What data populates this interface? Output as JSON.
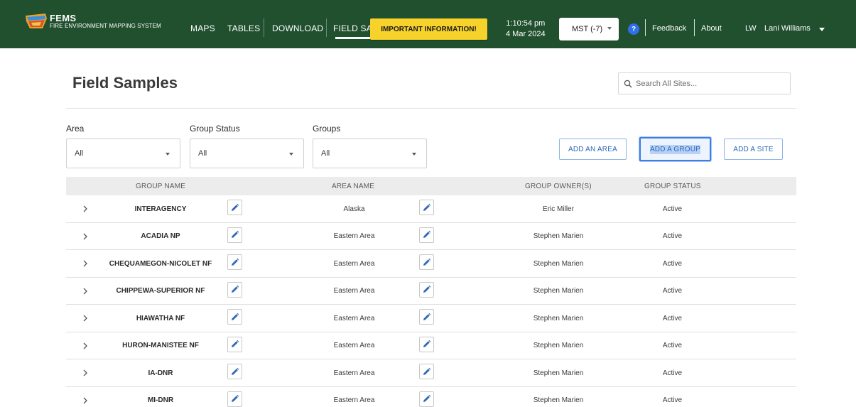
{
  "header": {
    "brand_name": "FEMS",
    "brand_subtitle": "FIRE ENVIRONMENT MAPPING SYSTEM",
    "nav": [
      "MAPS",
      "TABLES",
      "DOWNLOAD",
      "FIELD SA"
    ],
    "active_nav": "FIELD SAMPLES",
    "important_label": "IMPORTANT INFORMATION!",
    "time": "1:10:54 pm",
    "date": "4 Mar 2024",
    "timezone": "MST (-7)",
    "help_label": "?",
    "feedback_label": "Feedback",
    "about_label": "About",
    "user_initials": "LW",
    "user_name": "Lani Williams",
    "colors": {
      "bar": "#21502f",
      "important": "#f6d22b",
      "help": "#2f6fe8"
    }
  },
  "page": {
    "title": "Field Samples",
    "search_placeholder": "Search All Sites..."
  },
  "filters": [
    {
      "label": "Area",
      "value": "All"
    },
    {
      "label": "Group Status",
      "value": "All"
    },
    {
      "label": "Groups",
      "value": "All"
    }
  ],
  "actions": {
    "add_area": "ADD AN AREA",
    "add_group": "ADD A GROUP",
    "add_site": "ADD A SITE"
  },
  "table": {
    "columns": [
      "GROUP NAME",
      "AREA NAME",
      "GROUP OWNER(S)",
      "GROUP STATUS"
    ],
    "rows": [
      {
        "group": "INTERAGENCY",
        "area": "Alaska",
        "owner": "Eric Miller",
        "status": "Active"
      },
      {
        "group": "ACADIA NP",
        "area": "Eastern Area",
        "owner": "Stephen Marien",
        "status": "Active"
      },
      {
        "group": "CHEQUAMEGON-NICOLET NF",
        "area": "Eastern Area",
        "owner": "Stephen Marien",
        "status": "Active"
      },
      {
        "group": "CHIPPEWA-SUPERIOR NF",
        "area": "Eastern Area",
        "owner": "Stephen Marien",
        "status": "Active"
      },
      {
        "group": "HIAWATHA NF",
        "area": "Eastern Area",
        "owner": "Stephen Marien",
        "status": "Active"
      },
      {
        "group": "HURON-MANISTEE NF",
        "area": "Eastern Area",
        "owner": "Stephen Marien",
        "status": "Active"
      },
      {
        "group": "IA-DNR",
        "area": "Eastern Area",
        "owner": "Stephen Marien",
        "status": "Active"
      },
      {
        "group": "MI-DNR",
        "area": "Eastern Area",
        "owner": "Stephen Marien",
        "status": "Active"
      }
    ]
  }
}
